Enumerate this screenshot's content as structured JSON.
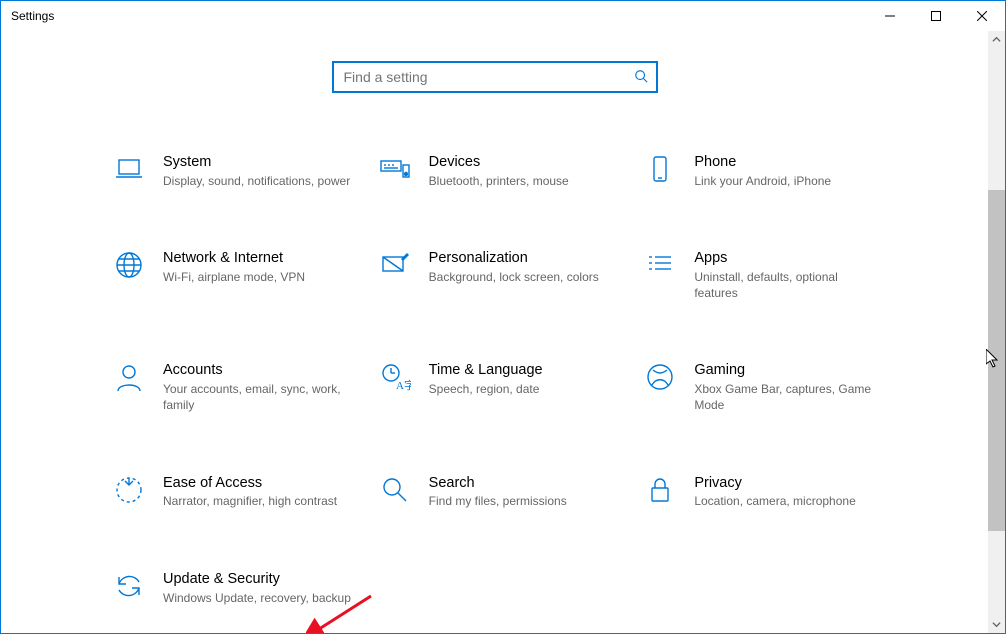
{
  "window": {
    "title": "Settings"
  },
  "search": {
    "placeholder": "Find a setting"
  },
  "categories": [
    {
      "id": "system",
      "title": "System",
      "desc": "Display, sound, notifications, power"
    },
    {
      "id": "devices",
      "title": "Devices",
      "desc": "Bluetooth, printers, mouse"
    },
    {
      "id": "phone",
      "title": "Phone",
      "desc": "Link your Android, iPhone"
    },
    {
      "id": "network",
      "title": "Network & Internet",
      "desc": "Wi-Fi, airplane mode, VPN"
    },
    {
      "id": "personalization",
      "title": "Personalization",
      "desc": "Background, lock screen, colors"
    },
    {
      "id": "apps",
      "title": "Apps",
      "desc": "Uninstall, defaults, optional features"
    },
    {
      "id": "accounts",
      "title": "Accounts",
      "desc": "Your accounts, email, sync, work, family"
    },
    {
      "id": "time",
      "title": "Time & Language",
      "desc": "Speech, region, date"
    },
    {
      "id": "gaming",
      "title": "Gaming",
      "desc": "Xbox Game Bar, captures, Game Mode"
    },
    {
      "id": "ease",
      "title": "Ease of Access",
      "desc": "Narrator, magnifier, high contrast"
    },
    {
      "id": "search",
      "title": "Search",
      "desc": "Find my files, permissions"
    },
    {
      "id": "privacy",
      "title": "Privacy",
      "desc": "Location, camera, microphone"
    },
    {
      "id": "update",
      "title": "Update & Security",
      "desc": "Windows Update, recovery, backup"
    }
  ],
  "colors": {
    "accent": "#0078d7"
  },
  "icons": {
    "system": "laptop-icon",
    "devices": "keyboard-speaker-icon",
    "phone": "phone-icon",
    "network": "globe-icon",
    "personalization": "paint-icon",
    "apps": "list-icon",
    "accounts": "person-icon",
    "time": "clock-language-icon",
    "gaming": "xbox-icon",
    "ease": "ease-of-access-icon",
    "search": "magnifier-icon",
    "privacy": "lock-icon",
    "update": "sync-icon"
  }
}
